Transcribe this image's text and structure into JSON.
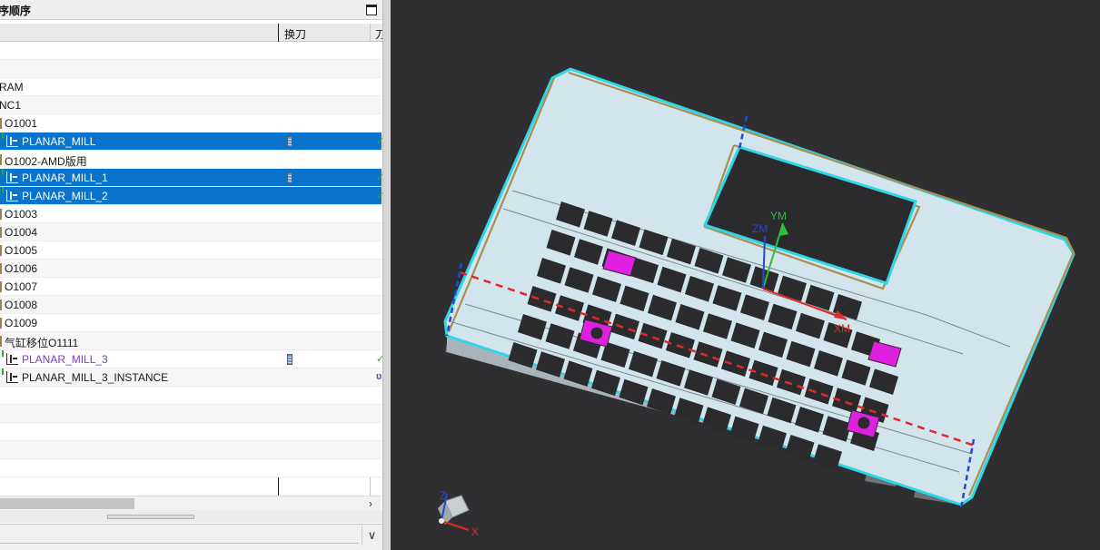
{
  "navigator": {
    "title": "序顺序",
    "columns": {
      "name": "",
      "tool_change": "换刀",
      "extra": "刀"
    },
    "rows": [
      {
        "name": "",
        "type": "root"
      },
      {
        "name": "",
        "type": "blank"
      },
      {
        "name": "RAM",
        "type": "program-root"
      },
      {
        "name": "NC1",
        "type": "group"
      },
      {
        "name": "O1001",
        "type": "program"
      },
      {
        "name": "PLANAR_MILL",
        "type": "operation",
        "selected": true,
        "tool_change": true,
        "status": "✓"
      },
      {
        "name": "O1002-AMD版用",
        "type": "program"
      },
      {
        "name": "PLANAR_MILL_1",
        "type": "operation",
        "selected": true,
        "tool_change": true,
        "status": "✓"
      },
      {
        "name": "PLANAR_MILL_2",
        "type": "operation",
        "selected": true,
        "tool_change": false,
        "status": "✓"
      },
      {
        "name": "O1003",
        "type": "program"
      },
      {
        "name": "O1004",
        "type": "program"
      },
      {
        "name": "O1005",
        "type": "program"
      },
      {
        "name": "O1006",
        "type": "program"
      },
      {
        "name": "O1007",
        "type": "program"
      },
      {
        "name": "O1008",
        "type": "program"
      },
      {
        "name": "O1009",
        "type": "program"
      },
      {
        "name": "气缸移位O1111",
        "type": "program"
      },
      {
        "name": "PLANAR_MILL_3",
        "type": "operation",
        "selected": false,
        "tool_change": true,
        "status": "✓",
        "highlight": "purple"
      },
      {
        "name": "PLANAR_MILL_3_INSTANCE",
        "type": "operation",
        "selected": false,
        "tool_change": false,
        "status": "ʋ",
        "status_color": "purple"
      },
      {
        "name": "",
        "type": "blank"
      },
      {
        "name": "",
        "type": "blank"
      },
      {
        "name": "",
        "type": "blank"
      },
      {
        "name": "",
        "type": "blank"
      },
      {
        "name": "",
        "type": "blank"
      },
      {
        "name": "",
        "type": "blank"
      }
    ],
    "scroll_right_glyph": "›",
    "details_expand_glyph": "∨"
  },
  "viewport": {
    "axis_labels": {
      "ym": "YM",
      "zm": "ZM",
      "xm": "XM"
    },
    "triad_labels": {
      "z": "Z",
      "x": "X"
    },
    "colors": {
      "background": "#2f2f31",
      "part_top": "#d3e5ec",
      "outline": "#2fd6e6",
      "toolpath": "#a88f52",
      "keys": "#2b2b2d",
      "highlight": "#e020e0",
      "axis_red": "#e02a2a",
      "axis_green": "#2fbf3a",
      "axis_blue": "#2646d6"
    }
  },
  "colors": {
    "selection": "#0a74cc",
    "status_ok": "#2fa32f",
    "status_purple": "#7b3fbf"
  }
}
